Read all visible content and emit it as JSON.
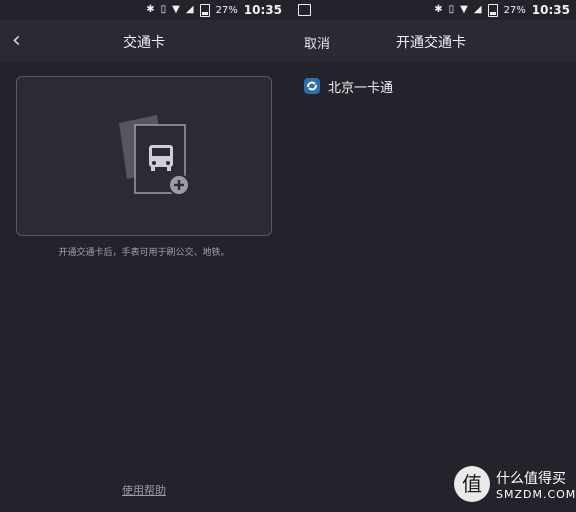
{
  "status_bar": {
    "battery": "27%",
    "time": "10:35",
    "icons": [
      "bluetooth-icon",
      "vibrate-icon",
      "wifi-icon",
      "signal-icon",
      "battery-icon"
    ]
  },
  "left": {
    "header": {
      "title": "交通卡"
    },
    "card_add": {
      "icon": "bus-card-add-icon"
    },
    "hint": "开通交通卡后，手表可用于刷公交、地铁。",
    "help_link": "使用帮助"
  },
  "right": {
    "header": {
      "cancel": "取消",
      "title": "开通交通卡"
    },
    "items": [
      {
        "label": "北京一卡通",
        "icon": "beijing-card-logo-icon",
        "accent": "#4a9fd8"
      }
    ]
  },
  "watermark": {
    "cn": "什么值得买",
    "en": "SMZDM.COM",
    "badge": "值"
  }
}
